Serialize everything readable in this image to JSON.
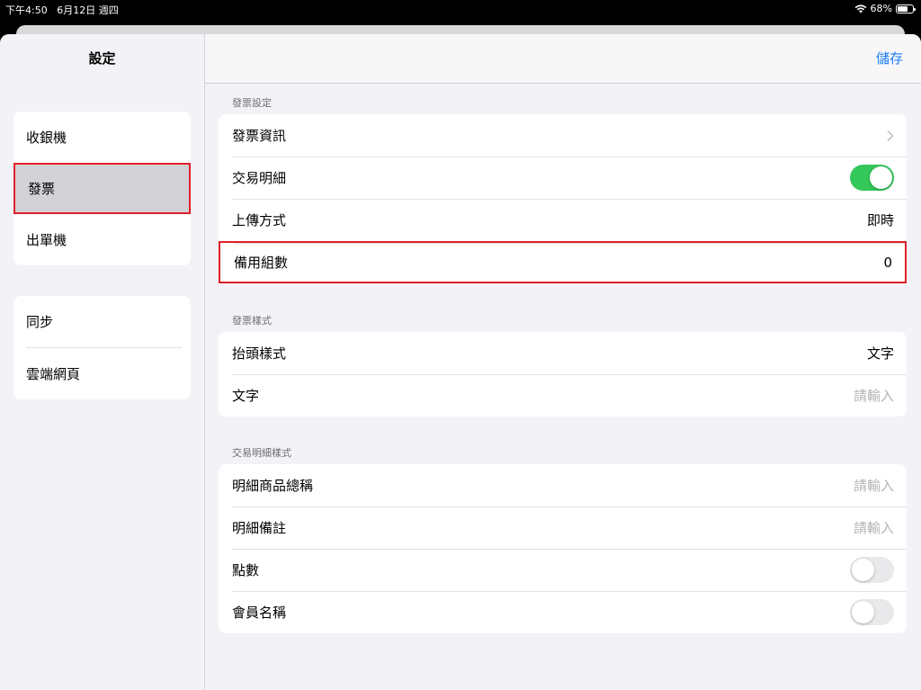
{
  "status_bar": {
    "time": "下午4:50",
    "date": "6月12日 週四",
    "battery_text": "68%",
    "battery_level": 0.68
  },
  "sidebar": {
    "title": "設定",
    "group1": [
      {
        "label": "收銀機"
      },
      {
        "label": "發票"
      },
      {
        "label": "出單機"
      }
    ],
    "group2": [
      {
        "label": "同步"
      },
      {
        "label": "雲端網頁"
      }
    ],
    "selected": "發票"
  },
  "navbar": {
    "save_label": "儲存"
  },
  "sections": {
    "invoice_settings": {
      "header": "發票設定",
      "invoice_info": "發票資訊",
      "transaction_detail": "交易明細",
      "transaction_detail_on": true,
      "upload_method": "上傳方式",
      "upload_method_value": "即時",
      "backup_count": "備用組數",
      "backup_count_value": "0"
    },
    "invoice_style": {
      "header": "發票樣式",
      "header_style": "抬頭樣式",
      "header_style_value": "文字",
      "text": "文字",
      "text_placeholder": "請輸入"
    },
    "detail_style": {
      "header": "交易明細樣式",
      "item_name": "明細商品總稱",
      "item_name_placeholder": "請輸入",
      "detail_note": "明細備註",
      "detail_note_placeholder": "請輸入",
      "points": "點數",
      "points_on": false,
      "member_name": "會員名稱",
      "member_name_on": false
    }
  },
  "colors": {
    "accent": "#1a7cf5",
    "toggle_on": "#34c759",
    "highlight": "#e0202a"
  }
}
